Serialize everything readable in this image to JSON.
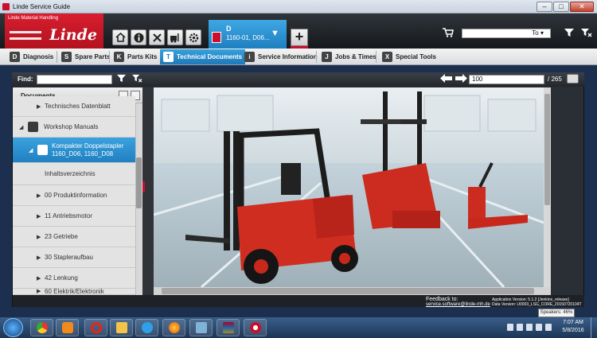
{
  "window": {
    "title": "Linde Service Guide",
    "min": "–",
    "max": "□",
    "close": "✕"
  },
  "header": {
    "brand_small": "Linde Material Handling",
    "brand_word": "Linde",
    "tools": [
      "home-icon",
      "info-icon",
      "tools-icon",
      "forklift-icon",
      "settings-icon"
    ],
    "vehicle_tab": {
      "line1": "D",
      "line2": "1160-01, D06..."
    },
    "plus_label": "+",
    "search_value": "To",
    "search_dropdown": "▾"
  },
  "nav": {
    "tabs": [
      {
        "label": "Diagnosis",
        "icon": "D"
      },
      {
        "label": "Spare Parts",
        "icon": "S"
      },
      {
        "label": "Parts Kits",
        "icon": "K"
      },
      {
        "label": "Technical Documents",
        "icon": "T"
      },
      {
        "label": "Service Information",
        "icon": "i"
      },
      {
        "label": "Jobs & Times",
        "icon": "J"
      },
      {
        "label": "Special Tools",
        "icon": "X"
      }
    ]
  },
  "findbar": {
    "label": "Find:",
    "page": "100",
    "total": "/ 265"
  },
  "sidebar": {
    "title": "Documents",
    "items": [
      {
        "label": "Technisches Datenblatt",
        "tri": "▶"
      },
      {
        "label": "Workshop Manuals",
        "tri": "◢"
      },
      {
        "label": "Kompakter Doppelstapler",
        "label2": "1160_D06, 1160_D08",
        "tri": "◢"
      },
      {
        "label": "Inhaltsverzeichnis",
        "tri": ""
      },
      {
        "label": "00 Produktinformation",
        "tri": "▶"
      },
      {
        "label": "11 Antriebsmotor",
        "tri": "▶"
      },
      {
        "label": "23 Getriebe",
        "tri": "▶"
      },
      {
        "label": "30 Stapleraufbau",
        "tri": "▶"
      },
      {
        "label": "42 Lenkung",
        "tri": "▶"
      },
      {
        "label": "60 Elektrik/Elektronik",
        "tri": "▶"
      }
    ]
  },
  "footer": {
    "feedback_label": "Feedback to:",
    "feedback_email": "service.software@linde-mh.de",
    "app_version": "Application Version: 5.1.2 [Jenkins_release]",
    "data_version": "Data Version: U0003_LSG_CORE_20150720104T"
  },
  "taskbar": {
    "time": "7:07 AM",
    "date": "5/8/2016",
    "tooltip": "Speakers: 46%"
  },
  "colors": {
    "brand_red": "#c8102e",
    "accent_blue": "#2488c9"
  }
}
